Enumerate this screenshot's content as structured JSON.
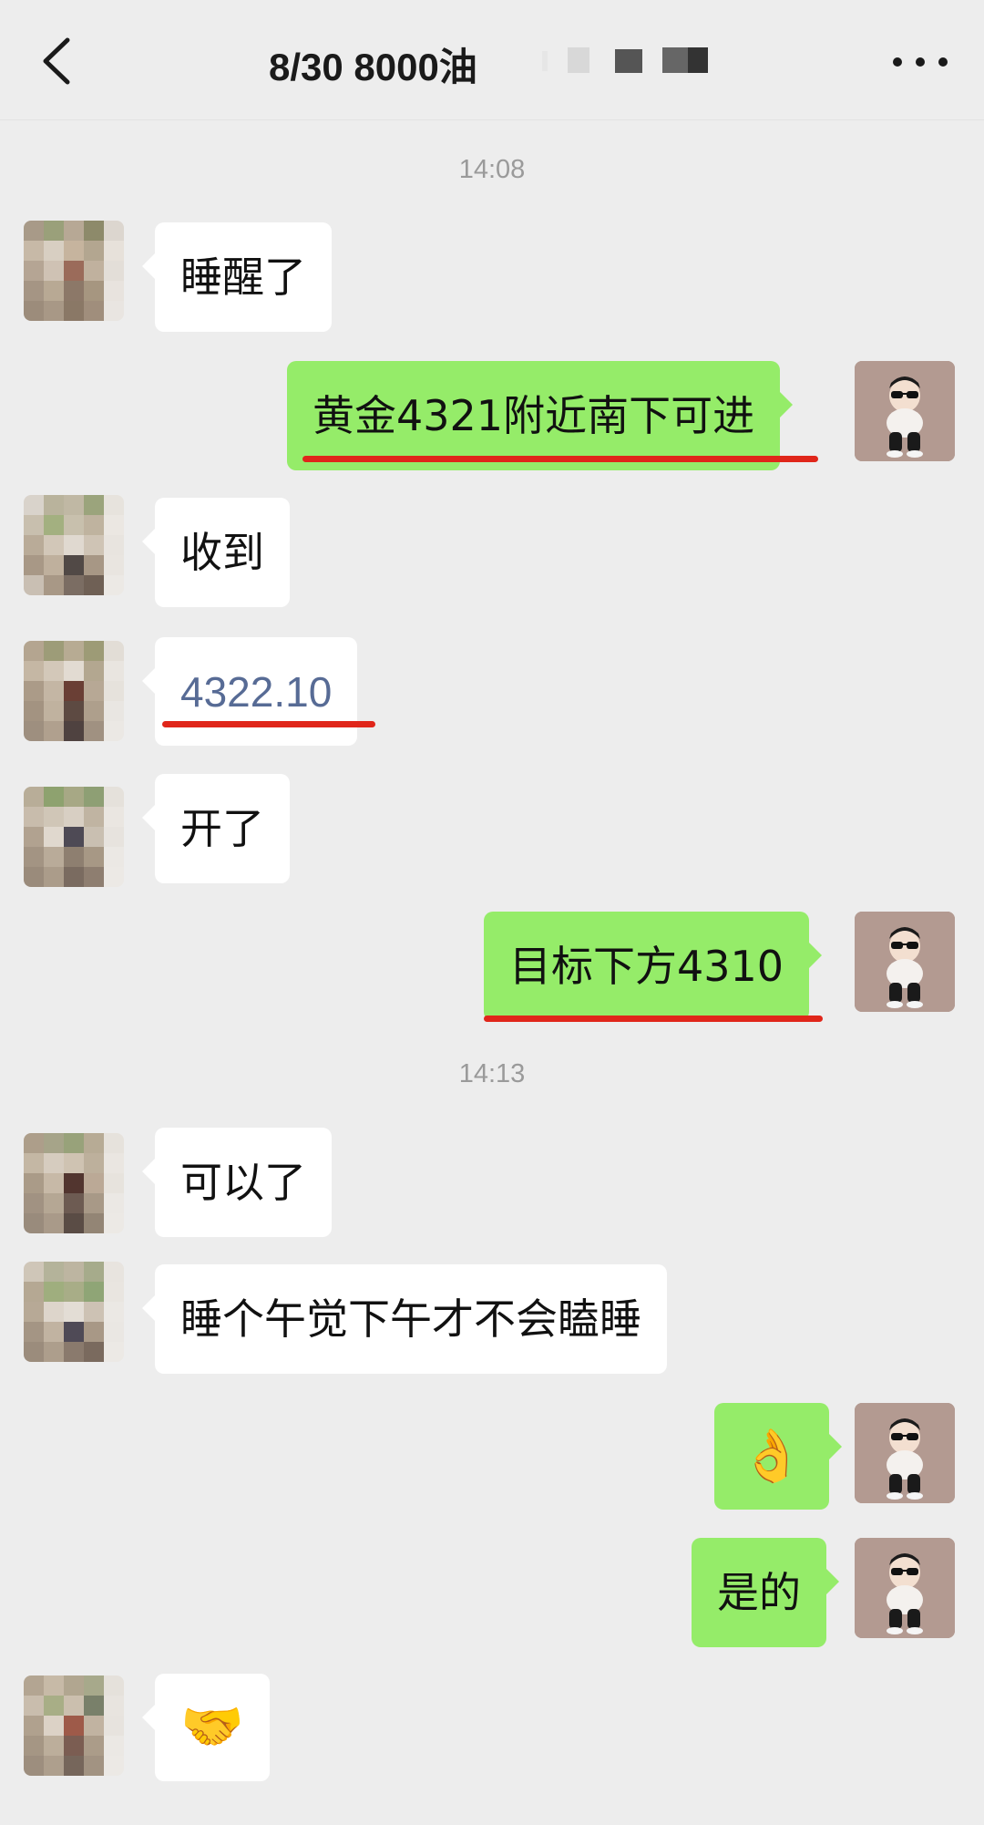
{
  "header": {
    "title": "8/30  8000油",
    "back_icon": "chevron-left-icon",
    "more_icon": "more-dots-icon"
  },
  "colors": {
    "background": "#ededed",
    "self_bubble": "#95ec69",
    "other_bubble": "#ffffff",
    "link_text": "#576b95",
    "annotation_underline": "#e0261a"
  },
  "timestamps": [
    "14:08",
    "14:13"
  ],
  "messages": [
    {
      "side": "left",
      "text": "睡醒了"
    },
    {
      "side": "right",
      "text": "黄金4321附近南下可进"
    },
    {
      "side": "left",
      "text": "收到"
    },
    {
      "side": "left",
      "text": "4322.10"
    },
    {
      "side": "left",
      "text": "开了"
    },
    {
      "side": "right",
      "text": "目标下方4310"
    },
    {
      "side": "left",
      "text": "可以了"
    },
    {
      "side": "left",
      "text": "睡个午觉下午才不会瞌睡"
    },
    {
      "side": "right",
      "text": "👌"
    },
    {
      "side": "right",
      "text": "是的"
    },
    {
      "side": "left",
      "text": "🤝"
    }
  ]
}
